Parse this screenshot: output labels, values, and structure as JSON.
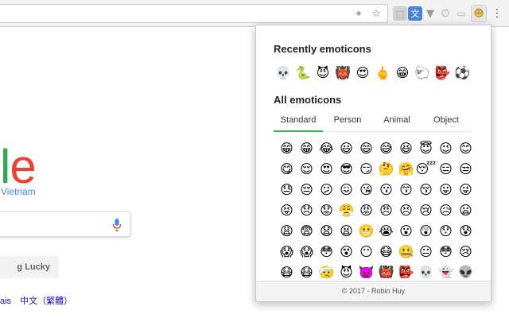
{
  "toolbar": {
    "icons": [
      "location-target-icon",
      "star-icon",
      "screenshot-ext-icon",
      "translate-ext-icon",
      "vpn-ext-icon",
      "link-ext-icon",
      "video-ext-icon",
      "emoticon-ext-icon",
      "menu-dots-icon"
    ]
  },
  "google": {
    "logo_fragment_l": "l",
    "logo_fragment_e": "e",
    "region": "Vietnam",
    "lucky_button": "g Lucky",
    "languages": [
      "ais",
      "中文（繁體）"
    ]
  },
  "popup": {
    "recent_title": "Recently emoticons",
    "recent": [
      "💀",
      "🐍",
      "😈",
      "👹",
      "😍",
      "🖕",
      "😁",
      "🐑",
      "👺",
      "⚽"
    ],
    "all_title": "All emoticons",
    "tabs": [
      {
        "label": "Standard",
        "active": true
      },
      {
        "label": "Person",
        "active": false
      },
      {
        "label": "Animal",
        "active": false
      },
      {
        "label": "Object",
        "active": false
      }
    ],
    "grid": [
      "😁",
      "😁",
      "😂",
      "😃",
      "😄",
      "😅",
      "😆",
      "😇",
      "😉",
      "😊",
      "😋",
      "😌",
      "😍",
      "😎",
      "😏",
      "🤔",
      "🤗",
      "😴",
      "😑",
      "😒",
      "😓",
      "😔",
      "😕",
      "😖",
      "😘",
      "😗",
      "😙",
      "😚",
      "😛",
      "😜",
      "😝",
      "😞",
      "😟",
      "😤",
      "😡",
      "😠",
      "😣",
      "😢",
      "😥",
      "😦",
      "😩",
      "😨",
      "😧",
      "😫",
      "😬",
      "😭",
      "😮",
      "😲",
      "😯",
      "😰",
      "😱",
      "😱",
      "😳",
      "😵",
      "😶",
      "😷",
      "🤐",
      "😐",
      "😳",
      "😢",
      "😷",
      "😷",
      "🤕",
      "😈",
      "👿",
      "👹",
      "👺",
      "💀",
      "👻",
      "👽"
    ],
    "footer": "© 2017 - Robin Huy"
  }
}
